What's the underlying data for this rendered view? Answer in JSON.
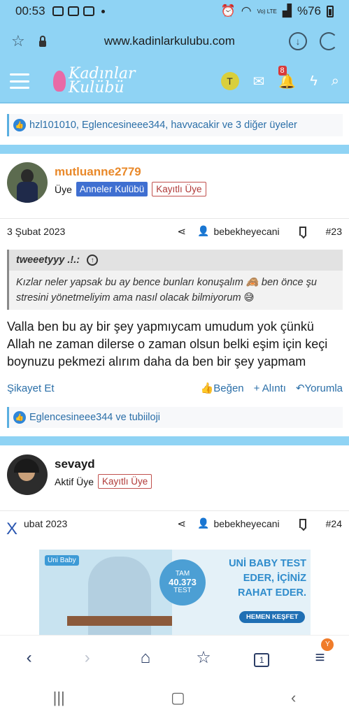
{
  "status_bar": {
    "time": "00:53",
    "battery": "%76",
    "network": "Vo) LTE"
  },
  "browser": {
    "url": "www.kadinlarkulubu.com"
  },
  "site_header": {
    "logo_line1": "Kadınlar",
    "logo_line2": "Kulübü",
    "user_initial": "T",
    "alerts_badge": "8"
  },
  "posts": [
    {
      "reactions": "hzl101010, Eglencesineee344, havvacakir ve 3 diğer üyeler"
    },
    {
      "username": "mutluanne2779",
      "role": "Üye",
      "tag1": "Anneler Kulübü",
      "tag2": "Kayıtlı Üye",
      "date": "3 Şubat 2023",
      "author_ref": "bebekheyecani",
      "number": "#23",
      "quote_author": "tweeetyyy .!.:",
      "quote_text": "Kızlar neler yapsak bu ay bence bunları konuşalım 🙈 ben önce şu stresini yönetmeliyim ama nasıl olacak bilmiyorum 😅",
      "text": "Valla ben bu ay bir şey yapmıycam umudum yok çünkü Allah ne zaman dilerse o zaman olsun belki eşim için keçi boynuzu pekmezi alırım daha da ben bir şey yapmam",
      "report": "Şikayet Et",
      "like": "Beğen",
      "quote": "+ Alıntı",
      "reply": "Yorumla",
      "reactions": "Eglencesineee344 ve tubiiloji"
    },
    {
      "username": "sevayd",
      "role": "Aktif Üye",
      "tag1": "Kayıtlı Üye",
      "date": "ubat 2023",
      "author_ref": "bebekheyecani",
      "number": "#24"
    }
  ],
  "ad": {
    "close": "X",
    "logo": "Uni Baby",
    "badge_line1": "TAM",
    "badge_line2": "40.373",
    "badge_line3": "TEST",
    "title": "UNİ BABY TEST EDER, İÇİNİZ RAHAT EDER.",
    "cta": "HEMEN KEŞFET"
  },
  "bottom_nav": {
    "tab_count": "1",
    "menu_badge": "Y"
  }
}
